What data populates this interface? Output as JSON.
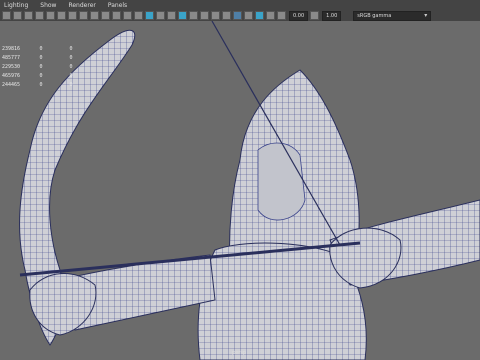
{
  "menu": [
    "Lighting",
    "Show",
    "Renderer",
    "Panels"
  ],
  "toolbar": {
    "exposure": "0.00",
    "gamma": "1.00",
    "color_space": "sRGB gamma",
    "accent": "#3aa3c8"
  },
  "hud": [
    [
      "239816",
      "0",
      "0"
    ],
    [
      "485777",
      "0",
      "0"
    ],
    [
      "229530",
      "0",
      "0"
    ],
    [
      "465976",
      "0",
      "0"
    ],
    [
      "244465",
      "0",
      "0"
    ]
  ],
  "camera_label": "persp"
}
